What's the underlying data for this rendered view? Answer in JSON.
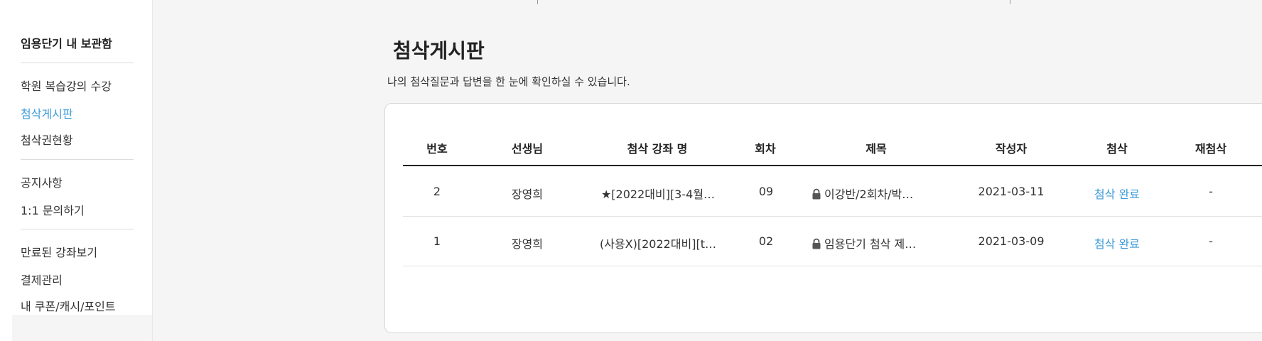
{
  "sidebar": {
    "title": "임용단기 내 보관함",
    "group1": [
      "학원 복습강의 수강",
      "첨삭게시판",
      "첨삭권현황"
    ],
    "group2": [
      "공지사항",
      "1:1 문의하기"
    ],
    "group3": [
      "만료된 강좌보기",
      "결제관리",
      "내 쿠폰/캐시/포인트"
    ],
    "active": "첨삭게시판"
  },
  "main": {
    "title": "첨삭게시판",
    "description": "나의 첨삭질문과 답변을 한 눈에 확인하실 수 있습니다."
  },
  "table": {
    "headers": [
      "번호",
      "선생님",
      "첨삭 강좌 명",
      "회차",
      "제목",
      "작성자",
      "첨삭",
      "재첨삭"
    ],
    "rows": [
      {
        "no": "2",
        "teacher": "장영희",
        "course": "★[2022대비][3-4월…",
        "session": "09",
        "title": "이강반/2회차/박…",
        "date": "2021-03-11",
        "status": "첨삭 완료",
        "recheck": "-",
        "locked": true
      },
      {
        "no": "1",
        "teacher": "장영희",
        "course": "(사용X)[2022대비][t…",
        "session": "02",
        "title": "임용단기 첨삭 제…",
        "date": "2021-03-09",
        "status": "첨삭 완료",
        "recheck": "-",
        "locked": true
      }
    ]
  },
  "colors": {
    "accent": "#3a9bd8",
    "text": "#222222",
    "border": "#d8d8d8"
  },
  "icons": {
    "lock": "lock-icon"
  }
}
